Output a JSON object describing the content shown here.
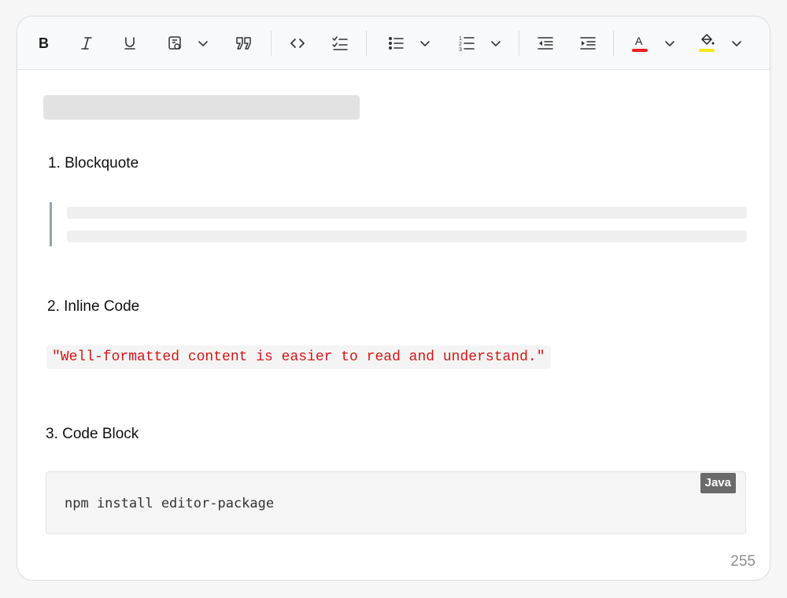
{
  "toolbar": {
    "items": [
      {
        "name": "bold-button",
        "icon": "bold-icon"
      },
      {
        "name": "italic-button",
        "icon": "italic-icon"
      },
      {
        "name": "underline-button",
        "icon": "underline-icon"
      },
      {
        "name": "format-painter-button",
        "icon": "format-painter-icon"
      },
      {
        "name": "blockquote-button",
        "icon": "quote-icon"
      },
      {
        "name": "inline-code-button",
        "icon": "code-icon"
      },
      {
        "name": "checklist-button",
        "icon": "checklist-icon"
      },
      {
        "name": "bulleted-list-button",
        "icon": "bulleted-list-icon"
      },
      {
        "name": "numbered-list-button",
        "icon": "numbered-list-icon"
      },
      {
        "name": "outdent-button",
        "icon": "outdent-icon"
      },
      {
        "name": "indent-button",
        "icon": "indent-icon"
      },
      {
        "name": "font-color-button",
        "icon": "font-color-icon",
        "color": "#e8221b"
      },
      {
        "name": "highlight-color-button",
        "icon": "paint-bucket-icon",
        "color": "#f3e81c"
      }
    ]
  },
  "content": {
    "section1": {
      "heading": "1. Blockquote"
    },
    "section2": {
      "heading": "2. Inline Code",
      "code": "\"Well-formatted content is easier to read and understand.\""
    },
    "section3": {
      "heading": "3. Code Block",
      "code": "npm install editor-package",
      "language": "Java"
    }
  },
  "footer": {
    "character_count": "255"
  },
  "colors": {
    "inline_code": "#d01818",
    "badge_bg": "#6b6b6b"
  }
}
